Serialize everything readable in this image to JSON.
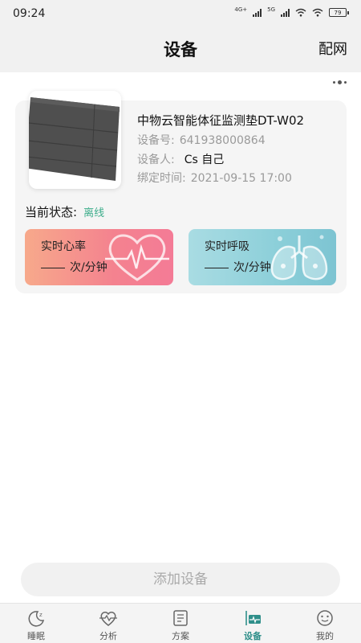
{
  "status_bar": {
    "time": "09:24",
    "network1": "4G+",
    "network2": "5G",
    "battery": "79"
  },
  "header": {
    "title": "设备",
    "action": "配网"
  },
  "device": {
    "name": "中物云智能体征监测垫DT-W02",
    "number_label": "设备号:",
    "number": "641938000864",
    "user_label": "设备人:",
    "user": "Cs 自己",
    "bind_label": "绑定时间:",
    "bind_time": "2021-09-15 17:00"
  },
  "status": {
    "label": "当前状态:",
    "value": "离线",
    "value_color": "#3fae8c"
  },
  "metrics": {
    "heart": {
      "label": "实时心率",
      "unit": "次/分钟"
    },
    "breath": {
      "label": "实时呼吸",
      "unit": "次/分钟"
    }
  },
  "add_button": "添加设备",
  "tabs": [
    {
      "label": "睡眠",
      "icon": "moon-icon"
    },
    {
      "label": "分析",
      "icon": "heartbeat-icon"
    },
    {
      "label": "方案",
      "icon": "plan-icon"
    },
    {
      "label": "设备",
      "icon": "device-icon",
      "active": true
    },
    {
      "label": "我的",
      "icon": "face-icon"
    }
  ],
  "accent_color": "#2f8f8a"
}
